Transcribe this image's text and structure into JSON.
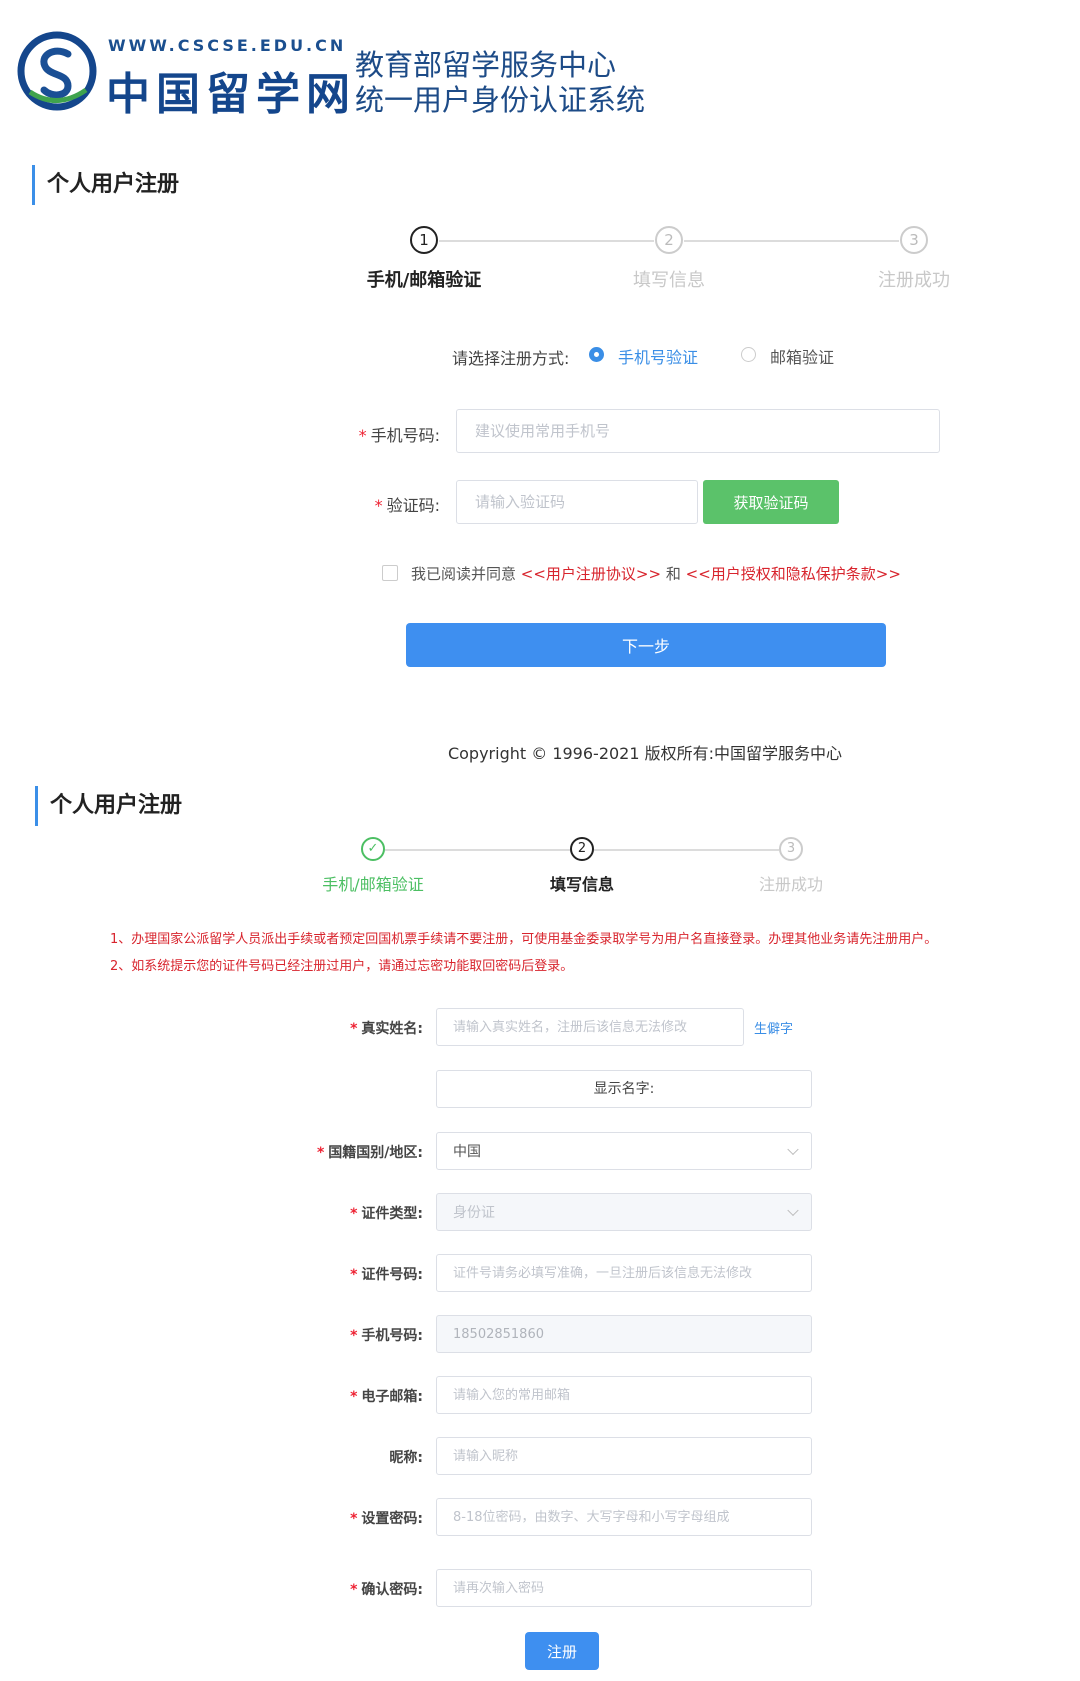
{
  "header": {
    "logo_url": "WWW.CSCSE.EDU.CN",
    "logo_name": "中国留学网",
    "system_line1": "教育部留学服务中心",
    "system_line2": "统一用户身份认证系统"
  },
  "screen1": {
    "title": "个人用户注册",
    "steps": [
      {
        "num": "1",
        "label": "手机/邮箱验证",
        "state": "active"
      },
      {
        "num": "2",
        "label": "填写信息",
        "state": "pending"
      },
      {
        "num": "3",
        "label": "注册成功",
        "state": "pending"
      }
    ],
    "method_label": "请选择注册方式:",
    "method_phone": "手机号验证",
    "method_email": "邮箱验证",
    "phone_label": "手机号码:",
    "phone_placeholder": "建议使用常用手机号",
    "code_label": "验证码:",
    "code_placeholder": "请输入验证码",
    "get_code_button": "获取验证码",
    "agree_prefix": "我已阅读并同意",
    "agreement_link": "<<用户注册协议>>",
    "agree_and": "和",
    "privacy_link": "<<用户授权和隐私保护条款>>",
    "next_button": "下一步",
    "copyright": "Copyright © 1996-2021 版权所有:中国留学服务中心"
  },
  "screen2": {
    "title": "个人用户注册",
    "steps": [
      {
        "num": "✓",
        "label": "手机/邮箱验证",
        "state": "done"
      },
      {
        "num": "2",
        "label": "填写信息",
        "state": "active"
      },
      {
        "num": "3",
        "label": "注册成功",
        "state": "pending"
      }
    ],
    "notice1": "1、办理国家公派留学人员派出手续或者预定回国机票手续请不要注册，可使用基金委录取学号为用户名直接登录。办理其他业务请先注册用户。",
    "notice2": "2、如系统提示您的证件号码已经注册过用户，请通过忘密功能取回密码后登录。",
    "real_name_label": "真实姓名:",
    "real_name_placeholder": "请输入真实姓名，注册后该信息无法修改",
    "rare_char_link": "生僻字",
    "display_name_label": "显示名字:",
    "nationality_label": "国籍国别/地区:",
    "nationality_value": "中国",
    "id_type_label": "证件类型:",
    "id_type_value": "身份证",
    "id_number_label": "证件号码:",
    "id_number_placeholder": "证件号请务必填写准确，一旦注册后该信息无法修改",
    "mobile_label": "手机号码:",
    "mobile_value": "18502851860",
    "email_label": "电子邮箱:",
    "email_placeholder": "请输入您的常用邮箱",
    "nickname_label": "昵称:",
    "nickname_placeholder": "请输入昵称",
    "password_label": "设置密码:",
    "password_placeholder": "8-18位密码，由数字、大写字母和小写字母组成",
    "confirm_label": "确认密码:",
    "confirm_placeholder": "请再次输入密码",
    "register_button": "注册"
  },
  "colors": {
    "primary_blue": "#3e8ff0",
    "success_green": "#5bc26a",
    "warning_red": "#d8242d",
    "brand_navy": "#14468c"
  }
}
